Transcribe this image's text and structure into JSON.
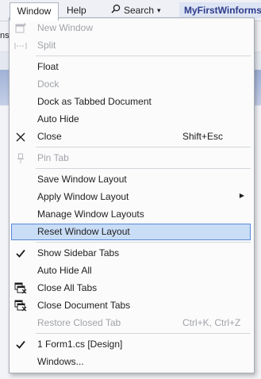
{
  "menubar": {
    "window": "Window",
    "help": "Help",
    "search": "Search",
    "solution_title": "MyFirstWinforms"
  },
  "background": {
    "toolbar_side_text": "ns"
  },
  "menu": {
    "items": [
      {
        "label": "New Window",
        "shortcut": "",
        "enabled": false,
        "icon": "new-window-icon"
      },
      {
        "label": "Split",
        "shortcut": "",
        "enabled": false,
        "icon": "split-icon"
      },
      {
        "label": "Float",
        "shortcut": "",
        "enabled": true
      },
      {
        "label": "Dock",
        "shortcut": "",
        "enabled": false
      },
      {
        "label": "Dock as Tabbed Document",
        "shortcut": "",
        "enabled": true
      },
      {
        "label": "Auto Hide",
        "shortcut": "",
        "enabled": true
      },
      {
        "label": "Close",
        "shortcut": "Shift+Esc",
        "enabled": true,
        "icon": "close-icon"
      },
      {
        "label": "Pin Tab",
        "shortcut": "",
        "enabled": false,
        "icon": "pin-icon"
      },
      {
        "label": "Save Window Layout",
        "shortcut": "",
        "enabled": true
      },
      {
        "label": "Apply Window Layout",
        "shortcut": "",
        "enabled": true,
        "submenu": true
      },
      {
        "label": "Manage Window Layouts",
        "shortcut": "",
        "enabled": true
      },
      {
        "label": "Reset Window Layout",
        "shortcut": "",
        "enabled": true,
        "highlighted": true
      },
      {
        "label": "Show Sidebar Tabs",
        "shortcut": "",
        "enabled": true,
        "checked": true
      },
      {
        "label": "Auto Hide All",
        "shortcut": "",
        "enabled": true
      },
      {
        "label": "Close All Tabs",
        "shortcut": "",
        "enabled": true,
        "icon": "close-all-tabs-icon"
      },
      {
        "label": "Close Document Tabs",
        "shortcut": "",
        "enabled": true,
        "icon": "close-document-tabs-icon"
      },
      {
        "label": "Restore Closed Tab",
        "shortcut": "Ctrl+K, Ctrl+Z",
        "enabled": false
      },
      {
        "label": "1 Form1.cs [Design]",
        "shortcut": "",
        "enabled": true,
        "checked": true
      },
      {
        "label": "Windows...",
        "shortcut": "",
        "enabled": true
      }
    ]
  },
  "colors": {
    "highlight_bg": "#c9ddf7",
    "highlight_border": "#5a88d6",
    "disabled_text": "#a1a3a8"
  }
}
